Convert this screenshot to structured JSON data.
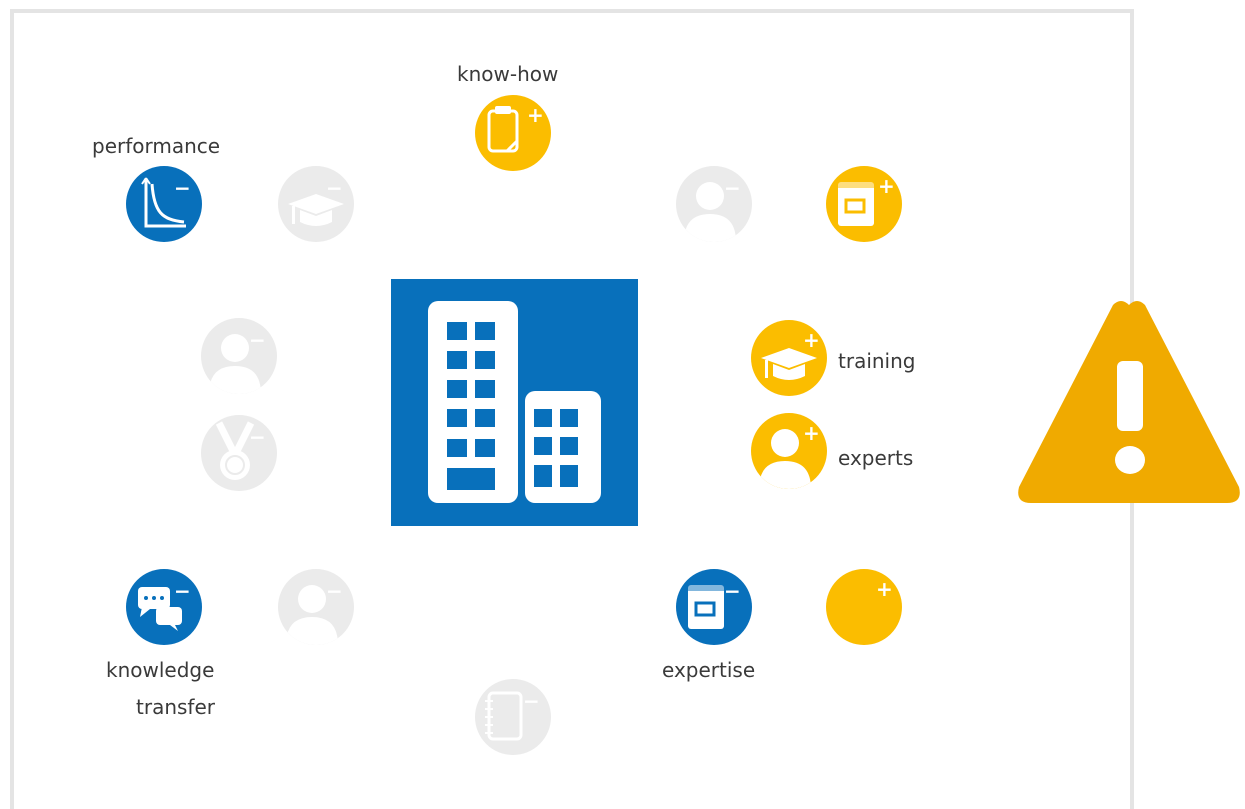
{
  "labels": {
    "know_how": "know-how",
    "performance": "performance",
    "training": "training",
    "experts": "experts",
    "knowledge": "knowledge",
    "transfer": "transfer",
    "expertise": "expertise"
  },
  "signs": {
    "plus": "+",
    "minus": "−"
  },
  "colors": {
    "blue": "#0870bb",
    "yellow": "#fbbd00",
    "grey": "#ebebeb",
    "warning": "#f0aa00",
    "frame": "#e4e4e4"
  },
  "icons": {
    "know_how": "clipboard-icon",
    "performance": "curve-chart-icon",
    "training": "graduation-cap-icon",
    "experts": "user-icon",
    "knowledge_transfer": "speech-bubbles-icon",
    "expertise": "document-icon",
    "center": "office-buildings-icon",
    "warning": "warning-icon"
  }
}
